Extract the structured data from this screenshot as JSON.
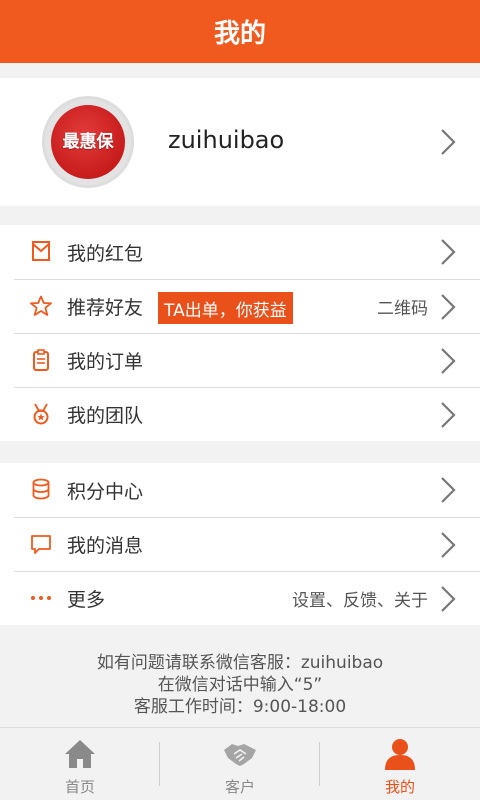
{
  "header": {
    "title": "我的"
  },
  "profile": {
    "avatar_text": "最惠保",
    "username": "zuihuibao"
  },
  "group1": [
    {
      "label": "我的红包",
      "icon": "envelope-icon"
    },
    {
      "label": "推荐好友",
      "icon": "star-icon",
      "promo": "TA出单，你获益",
      "right": "二维码"
    },
    {
      "label": "我的订单",
      "icon": "clipboard-icon"
    },
    {
      "label": "我的团队",
      "icon": "medal-icon"
    }
  ],
  "group2": [
    {
      "label": "积分中心",
      "icon": "database-icon"
    },
    {
      "label": "我的消息",
      "icon": "chat-icon"
    },
    {
      "label": "更多",
      "icon": "more-icon",
      "right": "设置、反馈、关于"
    }
  ],
  "footer": {
    "line1": "如有问题请联系微信客服：zuihuibao",
    "line2": "在微信对话中输入“5”",
    "line3": "客服工作时间：9:00-18:00"
  },
  "tabs": [
    {
      "label": "首页",
      "icon": "home-icon",
      "active": false
    },
    {
      "label": "客户",
      "icon": "handshake-icon",
      "active": false
    },
    {
      "label": "我的",
      "icon": "user-icon",
      "active": true
    }
  ],
  "colors": {
    "accent": "#f05a1e",
    "promo_bg": "#e9501a",
    "inactive": "#888888"
  }
}
